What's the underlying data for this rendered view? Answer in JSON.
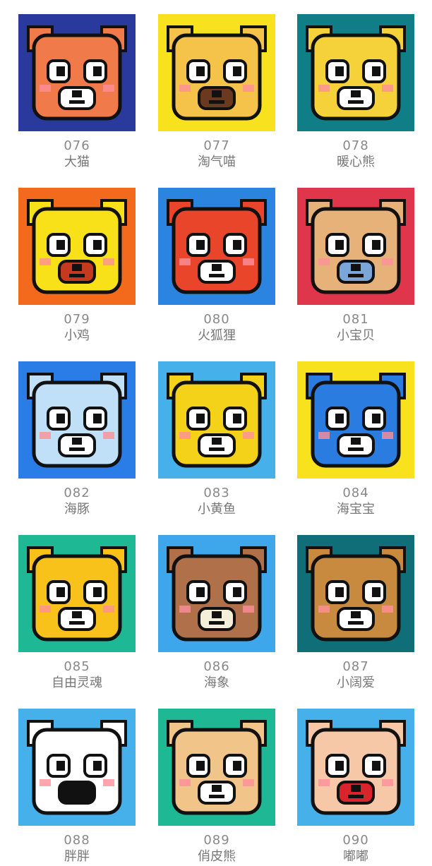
{
  "items": [
    {
      "number": "076",
      "name": "大猫",
      "icon": "tiger-cat-icon",
      "bg": "#2a3a9c",
      "face": "#f07a4a",
      "accent": "#ffffff"
    },
    {
      "number": "077",
      "name": "淘气喵",
      "icon": "naughty-cat-icon",
      "bg": "#f8e21e",
      "face": "#f5c34a",
      "accent": "#6b3a1e"
    },
    {
      "number": "078",
      "name": "暖心熊",
      "icon": "warm-bear-icon",
      "bg": "#0f7e86",
      "face": "#f6d23a",
      "accent": "#ffffff"
    },
    {
      "number": "079",
      "name": "小鸡",
      "icon": "chick-icon",
      "bg": "#f36a1c",
      "face": "#f9e11a",
      "accent": "#c43a1e"
    },
    {
      "number": "080",
      "name": "火狐狸",
      "icon": "fox-icon",
      "bg": "#2a84e0",
      "face": "#e8452a",
      "accent": "#ffffff"
    },
    {
      "number": "081",
      "name": "小宝贝",
      "icon": "teddy-bear-icon",
      "bg": "#e0364c",
      "face": "#e6b27a",
      "accent": "#7aa6d8"
    },
    {
      "number": "082",
      "name": "海豚",
      "icon": "dolphin-icon",
      "bg": "#2a7ce6",
      "face": "#bfe0f6",
      "accent": "#ffffff"
    },
    {
      "number": "083",
      "name": "小黄鱼",
      "icon": "yellow-fish-icon",
      "bg": "#45b0ea",
      "face": "#f4d21a",
      "accent": "#ffffff"
    },
    {
      "number": "084",
      "name": "海宝宝",
      "icon": "sea-monster-icon",
      "bg": "#f8e21e",
      "face": "#2a7ce0",
      "accent": "#ffffff"
    },
    {
      "number": "085",
      "name": "自由灵魂",
      "icon": "golden-fish-icon",
      "bg": "#1eb894",
      "face": "#f9c21a",
      "accent": "#ffffff"
    },
    {
      "number": "086",
      "name": "海象",
      "icon": "walrus-icon",
      "bg": "#3ea6ea",
      "face": "#b0704a",
      "accent": "#f4efd8"
    },
    {
      "number": "087",
      "name": "小阔爱",
      "icon": "puppy-icon",
      "bg": "#0f6e78",
      "face": "#c88a3e",
      "accent": "#ffffff"
    },
    {
      "number": "088",
      "name": "胖胖",
      "icon": "panda-icon",
      "bg": "#45b0ea",
      "face": "#ffffff",
      "accent": "#111111"
    },
    {
      "number": "089",
      "name": "俏皮熊",
      "icon": "lion-bear-icon",
      "bg": "#1eb894",
      "face": "#f1c48a",
      "accent": "#ffffff"
    },
    {
      "number": "090",
      "name": "嘟嘟",
      "icon": "bald-kid-icon",
      "bg": "#45b0ea",
      "face": "#f6c8a8",
      "accent": "#d8242a"
    }
  ]
}
